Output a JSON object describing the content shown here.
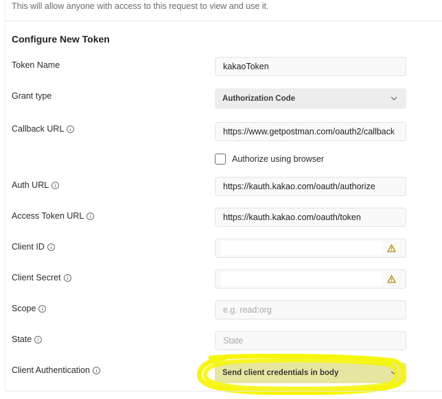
{
  "notice": "This will allow anyone with access to this request to view and use it.",
  "section_title": "Configure New Token",
  "fields": {
    "token_name": {
      "label": "Token Name",
      "value": "kakaoToken"
    },
    "grant_type": {
      "label": "Grant type",
      "value": "Authorization Code"
    },
    "callback_url": {
      "label": "Callback URL",
      "value": "https://www.getpostman.com/oauth2/callback"
    },
    "authorize_browser": {
      "label": "Authorize using browser",
      "checked": false
    },
    "auth_url": {
      "label": "Auth URL",
      "value": "https://kauth.kakao.com/oauth/authorize"
    },
    "access_token_url": {
      "label": "Access Token URL",
      "value": "https://kauth.kakao.com/oauth/token"
    },
    "client_id": {
      "label": "Client ID",
      "value": ""
    },
    "client_secret": {
      "label": "Client Secret",
      "value": ""
    },
    "scope": {
      "label": "Scope",
      "placeholder": "e.g. read:org"
    },
    "state": {
      "label": "State",
      "placeholder": "State"
    },
    "client_auth": {
      "label": "Client Authentication",
      "value": "Send client credentials in body"
    }
  },
  "colors": {
    "highlight": "#f5f500",
    "warning": "#b58a00",
    "field_bg": "#f9f9f9",
    "select_bg": "#ededed"
  },
  "icons": {
    "info": "info-icon",
    "warning": "warning-icon",
    "chevron": "chevron-down-icon"
  }
}
